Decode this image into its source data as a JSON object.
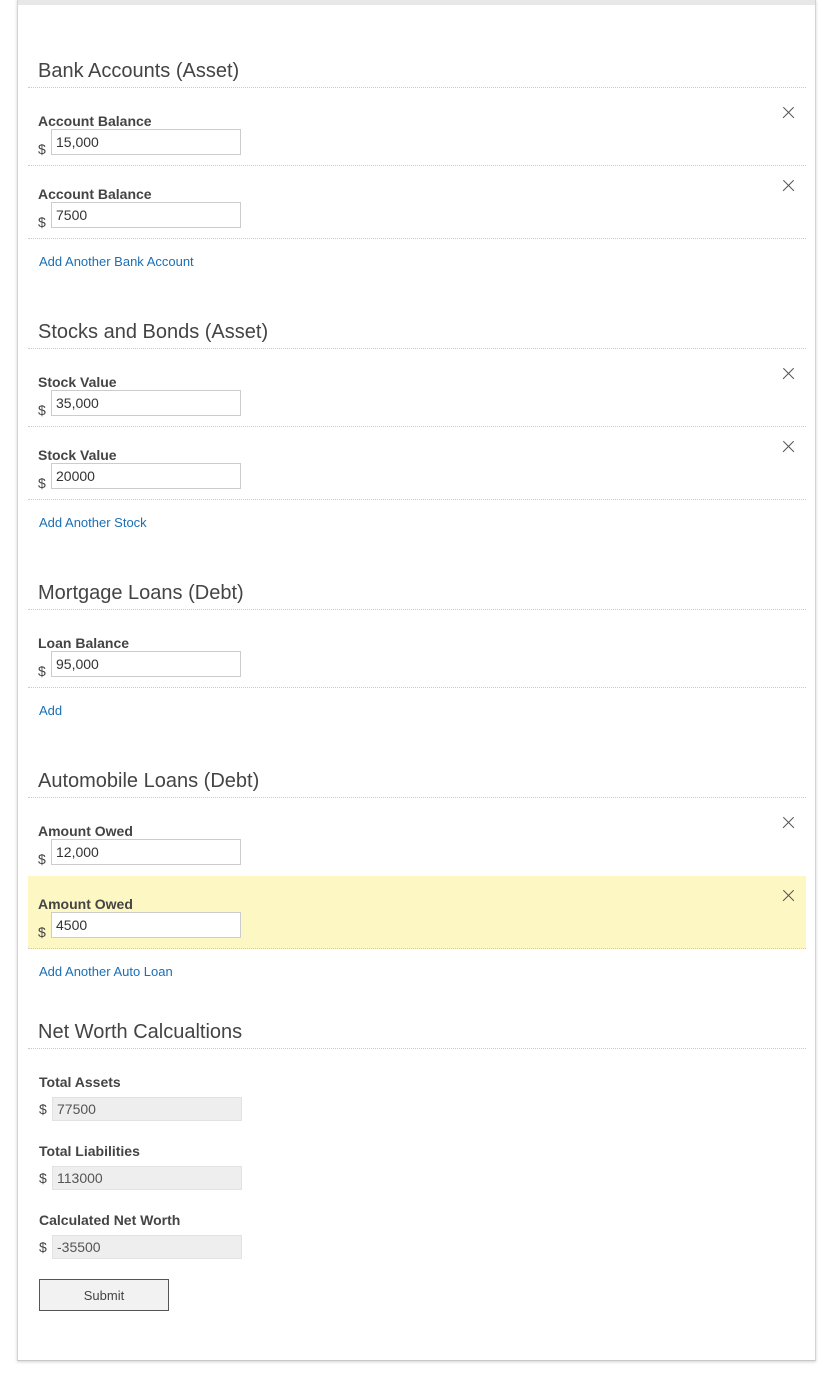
{
  "sections": {
    "bank": {
      "title": "Bank Accounts (Asset)",
      "rows": [
        {
          "label": "Account Balance",
          "currency": "$",
          "value": "15,000"
        },
        {
          "label": "Account Balance",
          "currency": "$",
          "value": "7500"
        }
      ],
      "add_label": "Add Another Bank Account"
    },
    "stocks": {
      "title": "Stocks and Bonds (Asset)",
      "rows": [
        {
          "label": "Stock Value",
          "currency": "$",
          "value": "35,000"
        },
        {
          "label": "Stock Value",
          "currency": "$",
          "value": "20000"
        }
      ],
      "add_label": "Add Another Stock"
    },
    "mortgage": {
      "title": "Mortgage Loans (Debt)",
      "rows": [
        {
          "label": "Loan Balance",
          "currency": "$",
          "value": "95,000"
        }
      ],
      "add_label": "Add"
    },
    "auto": {
      "title": "Automobile Loans (Debt)",
      "rows": [
        {
          "label": "Amount Owed",
          "currency": "$",
          "value": "12,000"
        },
        {
          "label": "Amount Owed",
          "currency": "$",
          "value": "4500",
          "highlighted": true
        }
      ],
      "add_label": "Add Another Auto Loan"
    }
  },
  "summary": {
    "title": "Net Worth Calcualtions",
    "total_assets": {
      "label": "Total Assets",
      "currency": "$",
      "value": "77500"
    },
    "total_liabilities": {
      "label": "Total Liabilities",
      "currency": "$",
      "value": "113000"
    },
    "net_worth": {
      "label": "Calculated Net Worth",
      "currency": "$",
      "value": "-35500"
    }
  },
  "submit_label": "Submit",
  "colors": {
    "link": "#1a6fb5",
    "highlight_row": "#fdf7c3",
    "readonly_field": "#eeeeee"
  },
  "icons": {
    "remove": "close-icon"
  }
}
